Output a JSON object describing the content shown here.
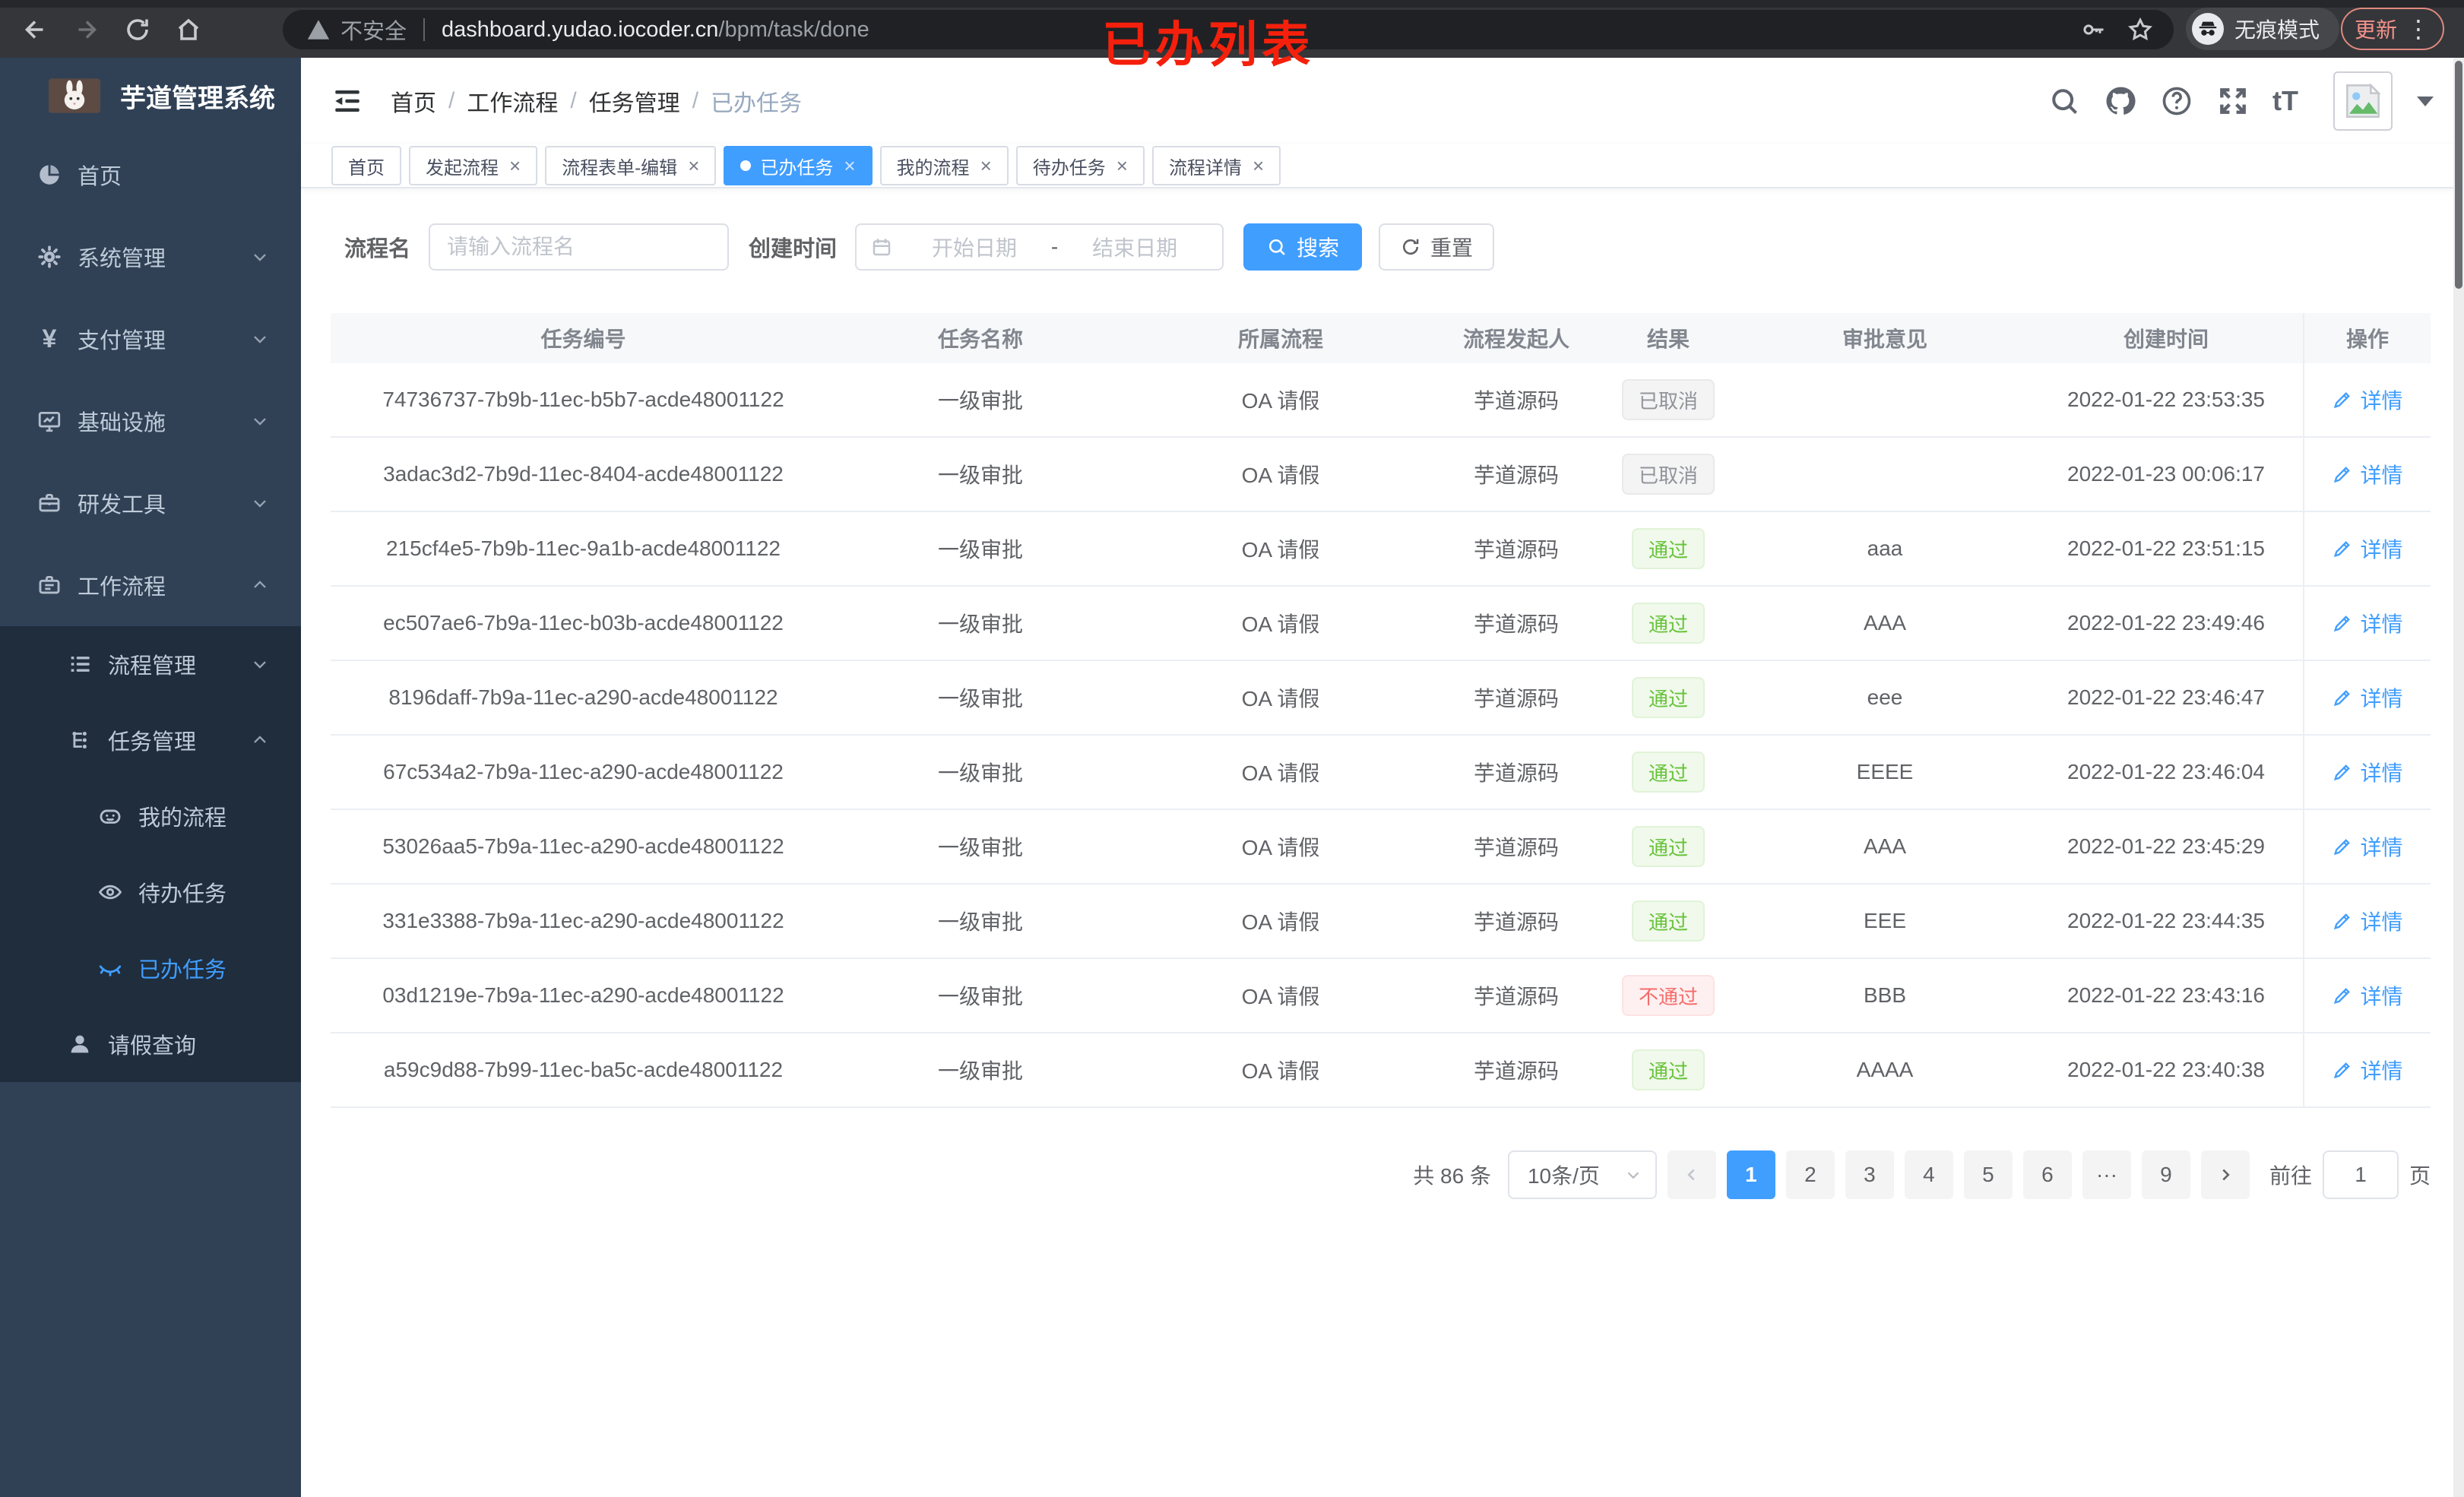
{
  "browser": {
    "security_label": "不安全",
    "url_domain": "dashboard.yudao.iocoder.cn",
    "url_path": "/bpm/task/done",
    "incognito_label": "无痕模式",
    "update_label": "更新",
    "annotation": "已办列表"
  },
  "colors": {
    "accent": "#409eff",
    "success": "#67c23a",
    "danger": "#f56c6c",
    "info": "#909399",
    "sidebar_bg": "#304156",
    "submenu_bg": "#1f2d3d",
    "table_header_bg": "#f7f8fa",
    "annotation_red": "#f5200c"
  },
  "sidebar": {
    "title": "芋道管理系统",
    "menu": [
      {
        "name": "home",
        "label": "首页",
        "icon": "dashboard-icon",
        "level": 1
      },
      {
        "name": "system-management",
        "label": "系统管理",
        "icon": "gear-icon",
        "level": 1,
        "chevron": "down"
      },
      {
        "name": "payment-management",
        "label": "支付管理",
        "icon": "yen-icon",
        "level": 1,
        "chevron": "down"
      },
      {
        "name": "infrastructure",
        "label": "基础设施",
        "icon": "infra-icon",
        "level": 1,
        "chevron": "down"
      },
      {
        "name": "dev-tools",
        "label": "研发工具",
        "icon": "tools-icon",
        "level": 1,
        "chevron": "down"
      },
      {
        "name": "workflow",
        "label": "工作流程",
        "icon": "workflow-icon",
        "level": 1,
        "chevron": "up"
      },
      {
        "name": "process-management",
        "label": "流程管理",
        "icon": "list-icon",
        "level": 2,
        "chevron": "down",
        "panel": true
      },
      {
        "name": "task-management",
        "label": "任务管理",
        "icon": "tree-icon",
        "level": 2,
        "chevron": "up",
        "panel": true
      },
      {
        "name": "my-process",
        "label": "我的流程",
        "icon": "chat-icon",
        "level": 3,
        "panel": true
      },
      {
        "name": "todo-tasks",
        "label": "待办任务",
        "icon": "eye-icon",
        "level": 3,
        "panel": true
      },
      {
        "name": "done-tasks",
        "label": "已办任务",
        "icon": "eye-closed-icon",
        "level": 3,
        "panel": true,
        "active": true
      },
      {
        "name": "leave-query",
        "label": "请假查询",
        "icon": "user-icon",
        "level": 2,
        "panel": true
      }
    ]
  },
  "header": {
    "breadcrumb": [
      "首页",
      "工作流程",
      "任务管理",
      "已办任务"
    ],
    "icons": [
      "search-icon",
      "github-icon",
      "help-icon",
      "fullscreen-icon",
      "fontsize-icon"
    ]
  },
  "tabs": [
    {
      "name": "home",
      "label": "首页"
    },
    {
      "name": "start-process",
      "label": "发起流程",
      "closable": true
    },
    {
      "name": "process-form-edit",
      "label": "流程表单-编辑",
      "closable": true
    },
    {
      "name": "done-tasks",
      "label": "已办任务",
      "closable": true,
      "active": true
    },
    {
      "name": "my-process",
      "label": "我的流程",
      "closable": true
    },
    {
      "name": "todo-tasks",
      "label": "待办任务",
      "closable": true
    },
    {
      "name": "process-detail",
      "label": "流程详情",
      "closable": true
    }
  ],
  "filters": {
    "name_label": "流程名",
    "name_placeholder": "请输入流程名",
    "time_label": "创建时间",
    "start_placeholder": "开始日期",
    "range_separator": "-",
    "end_placeholder": "结束日期",
    "search_label": "搜索",
    "reset_label": "重置"
  },
  "table": {
    "headers": [
      "任务编号",
      "任务名称",
      "所属流程",
      "流程发起人",
      "结果",
      "审批意见",
      "创建时间",
      "操作"
    ],
    "action_label": "详情",
    "rows": [
      {
        "id": "74736737-7b9b-11ec-b5b7-acde48001122",
        "name": "一级审批",
        "process": "OA 请假",
        "starter": "芋道源码",
        "result": "已取消",
        "result_type": "info",
        "comment": "",
        "created": "2022-01-22 23:53:35"
      },
      {
        "id": "3adac3d2-7b9d-11ec-8404-acde48001122",
        "name": "一级审批",
        "process": "OA 请假",
        "starter": "芋道源码",
        "result": "已取消",
        "result_type": "info",
        "comment": "",
        "created": "2022-01-23 00:06:17"
      },
      {
        "id": "215cf4e5-7b9b-11ec-9a1b-acde48001122",
        "name": "一级审批",
        "process": "OA 请假",
        "starter": "芋道源码",
        "result": "通过",
        "result_type": "success",
        "comment": "aaa",
        "created": "2022-01-22 23:51:15"
      },
      {
        "id": "ec507ae6-7b9a-11ec-b03b-acde48001122",
        "name": "一级审批",
        "process": "OA 请假",
        "starter": "芋道源码",
        "result": "通过",
        "result_type": "success",
        "comment": "AAA",
        "created": "2022-01-22 23:49:46"
      },
      {
        "id": "8196daff-7b9a-11ec-a290-acde48001122",
        "name": "一级审批",
        "process": "OA 请假",
        "starter": "芋道源码",
        "result": "通过",
        "result_type": "success",
        "comment": "eee",
        "created": "2022-01-22 23:46:47"
      },
      {
        "id": "67c534a2-7b9a-11ec-a290-acde48001122",
        "name": "一级审批",
        "process": "OA 请假",
        "starter": "芋道源码",
        "result": "通过",
        "result_type": "success",
        "comment": "EEEE",
        "created": "2022-01-22 23:46:04"
      },
      {
        "id": "53026aa5-7b9a-11ec-a290-acde48001122",
        "name": "一级审批",
        "process": "OA 请假",
        "starter": "芋道源码",
        "result": "通过",
        "result_type": "success",
        "comment": "AAA",
        "created": "2022-01-22 23:45:29"
      },
      {
        "id": "331e3388-7b9a-11ec-a290-acde48001122",
        "name": "一级审批",
        "process": "OA 请假",
        "starter": "芋道源码",
        "result": "通过",
        "result_type": "success",
        "comment": "EEE",
        "created": "2022-01-22 23:44:35"
      },
      {
        "id": "03d1219e-7b9a-11ec-a290-acde48001122",
        "name": "一级审批",
        "process": "OA 请假",
        "starter": "芋道源码",
        "result": "不通过",
        "result_type": "danger",
        "comment": "BBB",
        "created": "2022-01-22 23:43:16"
      },
      {
        "id": "a59c9d88-7b99-11ec-ba5c-acde48001122",
        "name": "一级审批",
        "process": "OA 请假",
        "starter": "芋道源码",
        "result": "通过",
        "result_type": "success",
        "comment": "AAAA",
        "created": "2022-01-22 23:40:38"
      }
    ]
  },
  "pagination": {
    "total_label": "共 86 条",
    "page_size_label": "10条/页",
    "pages": [
      {
        "label": "1",
        "active": true
      },
      {
        "label": "2"
      },
      {
        "label": "3"
      },
      {
        "label": "4"
      },
      {
        "label": "5"
      },
      {
        "label": "6"
      },
      {
        "label": "···",
        "ellipsis": true
      },
      {
        "label": "9"
      }
    ],
    "goto_prefix": "前往",
    "goto_value": "1",
    "goto_suffix": "页"
  }
}
